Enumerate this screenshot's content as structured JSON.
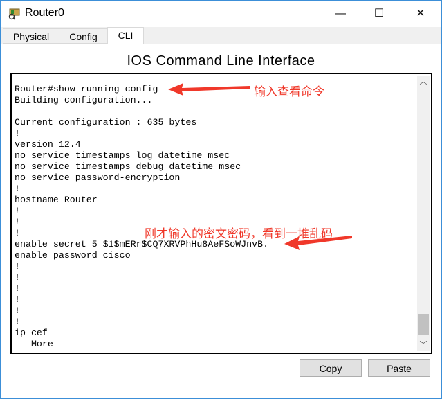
{
  "window": {
    "title": "Router0",
    "minimize": "—",
    "maximize": "☐",
    "close": "✕"
  },
  "tabs": [
    {
      "label": "Physical"
    },
    {
      "label": "Config"
    },
    {
      "label": "CLI",
      "active": true
    }
  ],
  "heading": "IOS Command Line Interface",
  "terminal": {
    "lines": [
      "Router#show running-config",
      "Building configuration...",
      "",
      "Current configuration : 635 bytes",
      "!",
      "version 12.4",
      "no service timestamps log datetime msec",
      "no service timestamps debug datetime msec",
      "no service password-encryption",
      "!",
      "hostname Router",
      "!",
      "!",
      "!",
      "enable secret 5 $1$mERr$CQ7XRVPhHu8AeFSoWJnvB.",
      "enable password cisco",
      "!",
      "!",
      "!",
      "!",
      "!",
      "!",
      "ip cef",
      " --More--"
    ],
    "scroll_position": 0.9
  },
  "annotations": {
    "first": "输入查看命令",
    "second": "刚才输入的密文密码，看到一堆乱码",
    "color": "#f0382a"
  },
  "buttons": {
    "copy": "Copy",
    "paste": "Paste"
  }
}
